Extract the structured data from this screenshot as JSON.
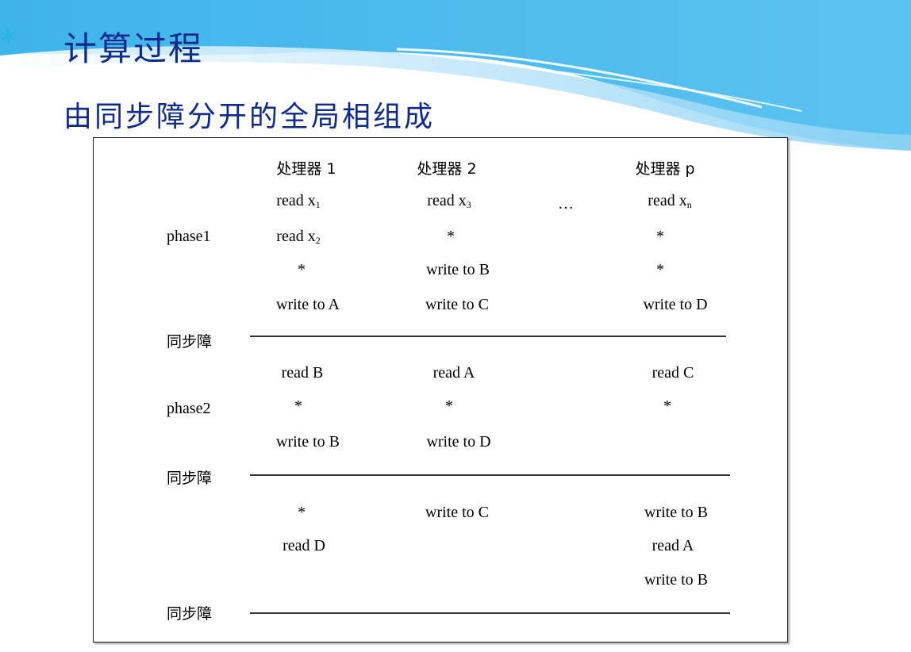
{
  "slide": {
    "bullet": "*",
    "title": "计算过程",
    "subtitle": "由同步障分开的全局相组成"
  },
  "figure": {
    "headers": {
      "p1": "处理器 1",
      "p2": "处理器 2",
      "pp": "处理器 p"
    },
    "ellipsis": "…",
    "phase_labels": {
      "phase1": "phase1",
      "phase2": "phase2"
    },
    "barrier_label": "同步障",
    "phase1": {
      "col1": [
        "read x",
        "read x",
        "*",
        "write to A"
      ],
      "col1_subs": [
        "1",
        "2"
      ],
      "col2": [
        "read x",
        "*",
        "write to B",
        "write to C"
      ],
      "col2_sub": "3",
      "colp": [
        "read x",
        "*",
        "*",
        "write to D"
      ],
      "colp_sub": "n"
    },
    "phase2": {
      "col1": [
        "read B",
        "*",
        "write to B"
      ],
      "col2": [
        "read A",
        "*",
        "write to D"
      ],
      "colp": [
        "read C",
        "*"
      ]
    },
    "phase3": {
      "col1": [
        "*",
        "read D"
      ],
      "col2": [
        "write to C"
      ],
      "colp": [
        "write to B",
        "read A",
        "write to B"
      ]
    }
  }
}
